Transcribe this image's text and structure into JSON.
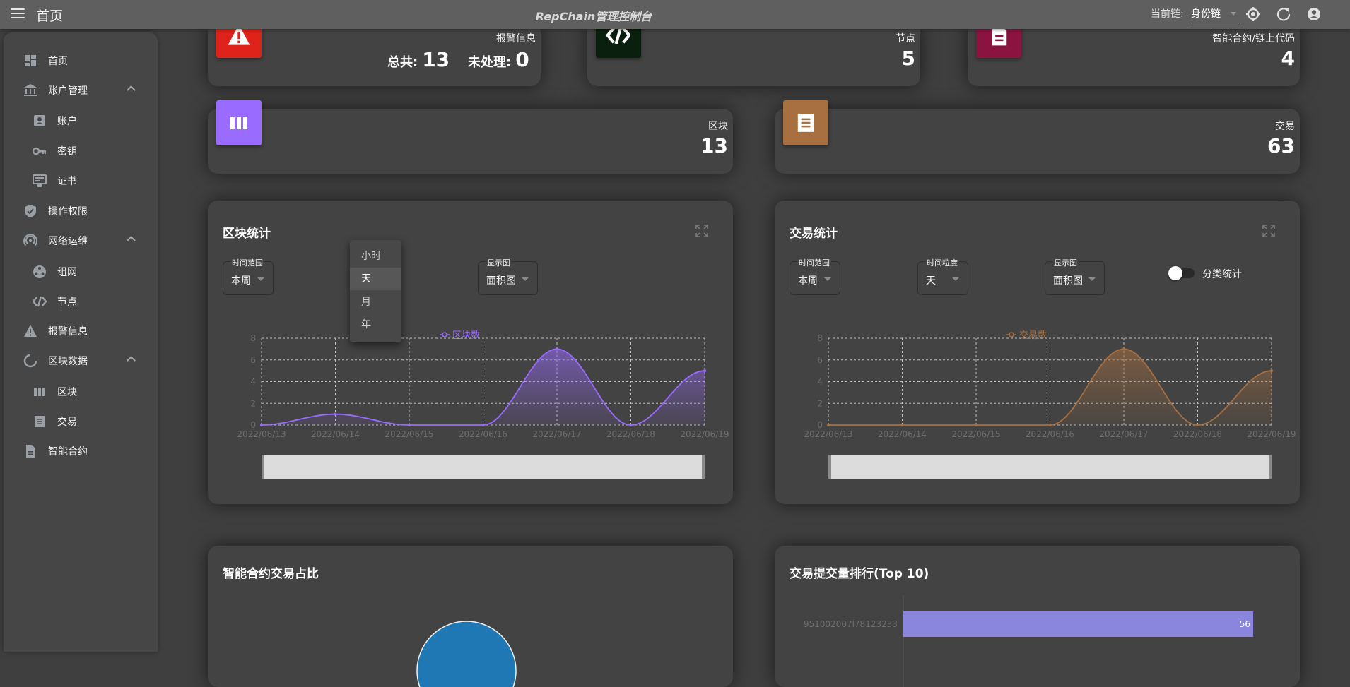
{
  "topbar": {
    "home_title": "首页",
    "app_title": "RepChain管理控制台",
    "chain_label": "当前链:",
    "chain_value": "身份链"
  },
  "sidebar": {
    "items": [
      {
        "label": "首页",
        "icon": "dashboard-icon"
      },
      {
        "label": "账户管理",
        "icon": "bank-icon",
        "expanded": true
      },
      {
        "label": "账户",
        "icon": "account-box-icon"
      },
      {
        "label": "密钥",
        "icon": "key-icon"
      },
      {
        "label": "证书",
        "icon": "certificate-icon"
      },
      {
        "label": "操作权限",
        "icon": "shield-check-icon"
      },
      {
        "label": "网络运维",
        "icon": "broadcast-icon",
        "expanded": true
      },
      {
        "label": "组网",
        "icon": "network-icon"
      },
      {
        "label": "节点",
        "icon": "code-icon"
      },
      {
        "label": "报警信息",
        "icon": "alert-icon"
      },
      {
        "label": "区块数据",
        "icon": "loading-circle-icon",
        "expanded": true
      },
      {
        "label": "区块",
        "icon": "blocks-icon"
      },
      {
        "label": "交易",
        "icon": "receipt-icon"
      },
      {
        "label": "智能合约",
        "icon": "document-icon"
      }
    ]
  },
  "stats": {
    "alerts": {
      "label": "报警信息",
      "total_label": "总共:",
      "total": "13",
      "pending_label": "未处理:",
      "pending": "0",
      "color": "#e0231a"
    },
    "nodes": {
      "label": "节点",
      "value": "5",
      "color": "#0a1f0d"
    },
    "contracts": {
      "label": "智能合约/链上代码",
      "value": "4",
      "color": "#8b1340"
    },
    "blocks": {
      "label": "区块",
      "value": "13",
      "color": "#9a6bff"
    },
    "transactions": {
      "label": "交易",
      "value": "63",
      "color": "#a87041"
    }
  },
  "block_panel": {
    "title": "区块统计",
    "range_caption": "时间范围",
    "range_value": "本周",
    "display_caption": "显示图",
    "display_value": "面积图",
    "granularity_options": [
      "小时",
      "天",
      "月",
      "年"
    ],
    "granularity_selected": "天"
  },
  "tx_panel": {
    "title": "交易统计",
    "range_caption": "时间范围",
    "range_value": "本周",
    "granularity_caption": "时间粒度",
    "granularity_value": "天",
    "display_caption": "显示图",
    "display_value": "面积图",
    "toggle_label": "分类统计",
    "toggle_on": false
  },
  "contract_panel": {
    "title": "智能合约交易占比"
  },
  "rank_panel": {
    "title": "交易提交量排行(Top 10)"
  },
  "chart_data": [
    {
      "type": "area",
      "x": [
        "2022/06/13",
        "2022/06/14",
        "2022/06/15",
        "2022/06/16",
        "2022/06/17",
        "2022/06/18",
        "2022/06/19"
      ],
      "series": [
        {
          "name": "区块数",
          "values": [
            0,
            1,
            0,
            0,
            7,
            0,
            5
          ],
          "color": "#9a6bff"
        }
      ],
      "ylim": [
        0,
        8
      ],
      "yticks": [
        "0",
        "2",
        "4",
        "6",
        "8"
      ],
      "grid": true,
      "legend": "top-center"
    },
    {
      "type": "area",
      "x": [
        "2022/06/13",
        "2022/06/14",
        "2022/06/15",
        "2022/06/16",
        "2022/06/17",
        "2022/06/18",
        "2022/06/19"
      ],
      "series": [
        {
          "name": "交易数",
          "values": [
            0,
            0,
            0,
            0,
            7,
            0,
            5
          ],
          "color": "#a87041"
        }
      ],
      "ylim": [
        0,
        8
      ],
      "yticks": [
        "0",
        "2",
        "4",
        "6",
        "8"
      ],
      "grid": true,
      "legend": "top-center"
    },
    {
      "type": "bar",
      "categories": [
        "951002007l78123233"
      ],
      "values": [
        56
      ],
      "color": "#8b86dd"
    }
  ]
}
